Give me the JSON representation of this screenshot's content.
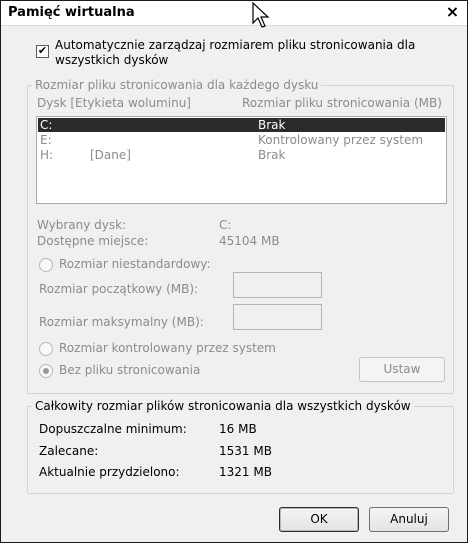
{
  "window": {
    "title": "Pamięć wirtualna",
    "close_glyph": "×"
  },
  "auto_manage": {
    "checked": true,
    "check_glyph": "✔",
    "line1": "Automatycznie zarządzaj rozmiarem pliku stronicowania dla",
    "line2": "wszystkich dysków"
  },
  "per_drive": {
    "group_label": "Rozmiar pliku stronicowania dla każdego dysku",
    "col_drive": "Dysk [Etykieta woluminu]",
    "col_size": "Rozmiar pliku stronicowania (MB)",
    "drives": [
      {
        "drive": "C:",
        "label": "",
        "size": "Brak",
        "selected": true
      },
      {
        "drive": "E:",
        "label": "",
        "size": "Kontrolowany przez system",
        "selected": false
      },
      {
        "drive": "H:",
        "label": "[Dane]",
        "size": "Brak",
        "selected": false
      }
    ],
    "selected_drive_label": "Wybrany dysk:",
    "selected_drive_value": "C:",
    "available_label": "Dostępne miejsce:",
    "available_value": "45104 MB",
    "custom_size_label": "Rozmiar niestandardowy:",
    "initial_label": "Rozmiar początkowy (MB):",
    "initial_value": "",
    "max_label": "Rozmiar maksymalny (MB):",
    "max_value": "",
    "system_managed_label": "Rozmiar kontrolowany przez system",
    "no_paging_label": "Bez pliku stronicowania",
    "set_button": "Ustaw"
  },
  "totals": {
    "group_label": "Całkowity rozmiar plików stronicowania dla wszystkich dysków",
    "min_label": "Dopuszczalne minimum:",
    "min_value": "16 MB",
    "recommended_label": "Zalecane:",
    "recommended_value": "1531 MB",
    "allocated_label": "Aktualnie przydzielono:",
    "allocated_value": "1321 MB"
  },
  "buttons": {
    "ok": "OK",
    "cancel": "Anuluj"
  }
}
